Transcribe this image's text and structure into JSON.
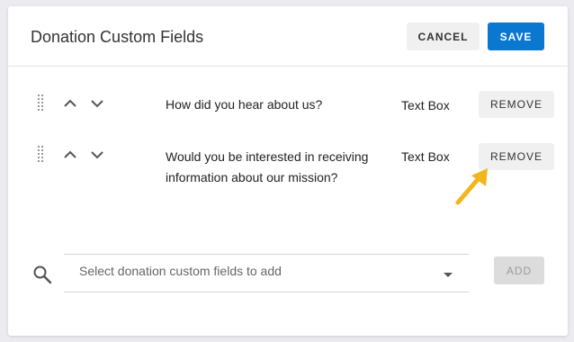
{
  "header": {
    "title": "Donation Custom Fields",
    "cancel_label": "CANCEL",
    "save_label": "SAVE"
  },
  "fields": [
    {
      "label": "How did you hear about us?",
      "type": "Text Box",
      "remove_label": "REMOVE"
    },
    {
      "label": "Would you be interested in receiving information about our mission?",
      "type": "Text Box",
      "remove_label": "REMOVE"
    }
  ],
  "add_section": {
    "placeholder": "Select donation custom fields to add",
    "add_label": "ADD"
  },
  "colors": {
    "primary": "#0a78d0",
    "pointer": "#f2b51c"
  },
  "icons": [
    "drag-handle-icon",
    "chevron-up-icon",
    "chevron-down-icon",
    "search-icon",
    "dropdown-caret-icon",
    "pointer-arrow-icon"
  ]
}
